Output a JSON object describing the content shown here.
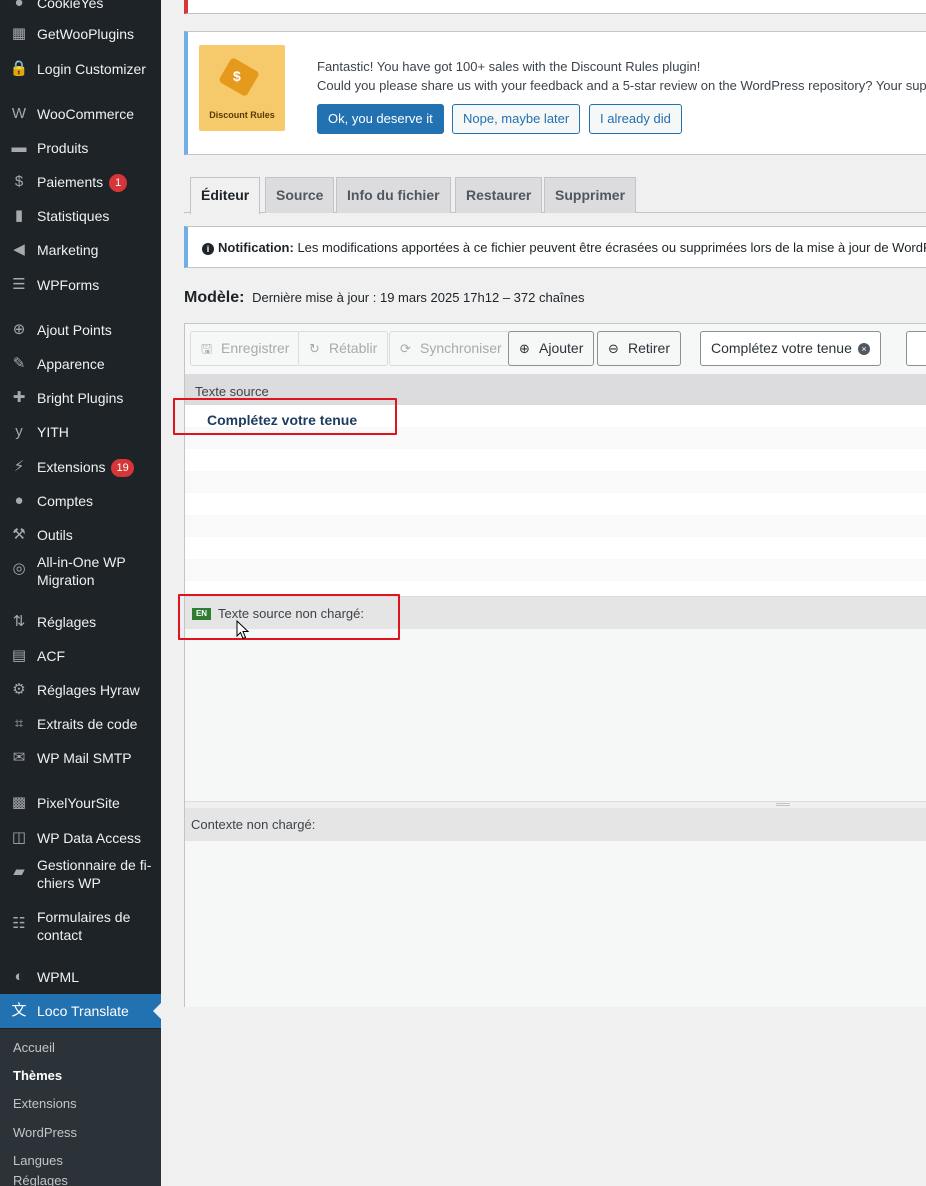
{
  "sidebar": {
    "top_partial": "CookieYes",
    "items": [
      {
        "label": "GetWooPlugins",
        "icon": "getwoo-icon"
      },
      {
        "label": "Login Customizer",
        "icon": "lock-icon"
      },
      {
        "label": "WooCommerce",
        "icon": "woo-icon"
      },
      {
        "label": "Produits",
        "icon": "archive-icon"
      },
      {
        "label": "Paiements",
        "icon": "dollar-icon",
        "badge": "1"
      },
      {
        "label": "Statistiques",
        "icon": "bar-chart-icon"
      },
      {
        "label": "Marketing",
        "icon": "megaphone-icon"
      },
      {
        "label": "WPForms",
        "icon": "form-icon"
      },
      {
        "label": "Ajout Points",
        "icon": "plus-circle-icon"
      },
      {
        "label": "Apparence",
        "icon": "paintbrush-icon"
      },
      {
        "label": "Bright Plugins",
        "icon": "puzzle-icon"
      },
      {
        "label": "YITH",
        "icon": "yith-icon"
      },
      {
        "label": "Extensions",
        "icon": "plugin-icon",
        "badge": "19"
      },
      {
        "label": "Comptes",
        "icon": "user-icon"
      },
      {
        "label": "Outils",
        "icon": "wrench-icon"
      },
      {
        "label": "All-in-One WP Migration",
        "icon": "migration-icon"
      },
      {
        "label": "Réglages",
        "icon": "settings-sliders-icon"
      },
      {
        "label": "ACF",
        "icon": "acf-icon"
      },
      {
        "label": "Réglages Hyraw",
        "icon": "gear-icon"
      },
      {
        "label": "Extraits de code",
        "icon": "code-icon"
      },
      {
        "label": "WP Mail SMTP",
        "icon": "mail-icon"
      },
      {
        "label": "PixelYourSite",
        "icon": "pixel-icon"
      },
      {
        "label": "WP Data Access",
        "icon": "database-icon"
      },
      {
        "label": "Gestionnaire de fi-chiers WP",
        "icon": "folder-icon"
      },
      {
        "label": "Formulaires de contact",
        "icon": "contact-form-icon"
      },
      {
        "label": "WPML",
        "icon": "wpml-icon"
      },
      {
        "label": "Loco Translate",
        "icon": "translate-icon"
      }
    ],
    "submenu": [
      {
        "label": "Accueil"
      },
      {
        "label": "Thèmes"
      },
      {
        "label": "Extensions"
      },
      {
        "label": "WordPress"
      },
      {
        "label": "Langues"
      },
      {
        "label": "Réglages"
      }
    ]
  },
  "discount_notice": {
    "logo_text": "Discount Rules",
    "line1": "Fantastic! You have got 100+ sales with the Discount Rules plugin!",
    "line2": "Could you please share us with your feedback and a 5-star review on the WordPress repository? Your support",
    "btn_ok": "Ok, you deserve it",
    "btn_later": "Nope, maybe later",
    "btn_did": "I already did"
  },
  "tabs": [
    "Éditeur",
    "Source",
    "Info du fichier",
    "Restaurer",
    "Supprimer"
  ],
  "info_notice": {
    "label": "Notification:",
    "text": "Les modifications apportées à ce fichier peuvent être écrasées ou supprimées lors de la mise à jour de WordPress"
  },
  "model": {
    "label": "Modèle:",
    "info": "Dernière mise à jour : 19 mars 2025 17h12 – 372 chaînes"
  },
  "toolbar": {
    "save": "Enregistrer",
    "revert": "Rétablir",
    "sync": "Synchroniser",
    "add": "Ajouter",
    "remove": "Retirer",
    "filter_value": "Complétez votre tenue"
  },
  "list": {
    "header": "Texte source",
    "selected_row": "Complétez votre tenue"
  },
  "source_panel": {
    "lang_badge": "EN",
    "label": "Texte source non chargé:"
  },
  "context_panel": {
    "label": "Contexte non chargé:"
  }
}
